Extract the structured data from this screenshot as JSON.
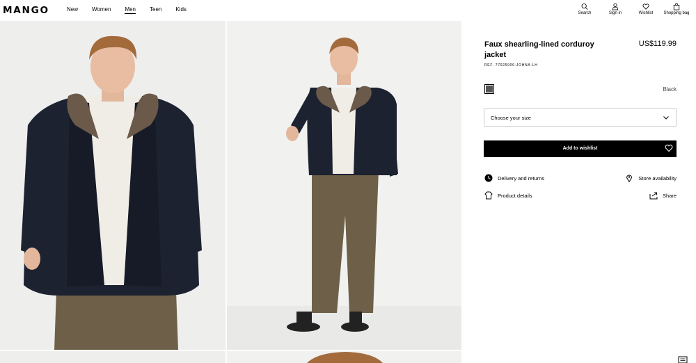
{
  "header": {
    "logo": "MANGO",
    "nav": [
      "New",
      "Women",
      "Men",
      "Teen",
      "Kids"
    ],
    "icons": [
      {
        "label": "Search",
        "icon": "search-icon"
      },
      {
        "label": "Sign in",
        "icon": "user-icon"
      },
      {
        "label": "Wishlist",
        "icon": "heart-icon"
      },
      {
        "label": "Shopping bag",
        "icon": "bag-icon"
      }
    ]
  },
  "product": {
    "title": "Faux shearling-lined corduroy jacket",
    "price": "US$119.99",
    "ref": "REF. 77025906-JOHNA-LH",
    "color": "Black",
    "size_placeholder": "Choose your size",
    "add_button": "Add to wishlist"
  },
  "links": {
    "delivery": "Delivery and returns",
    "store": "Store availability",
    "details": "Product details",
    "share": "Share"
  },
  "colors": {
    "accent": "#000000",
    "photo_bg": "#eeeeed",
    "jacket": "#1c2230",
    "collar": "#6b5a4a",
    "trousers": "#6e6048"
  }
}
